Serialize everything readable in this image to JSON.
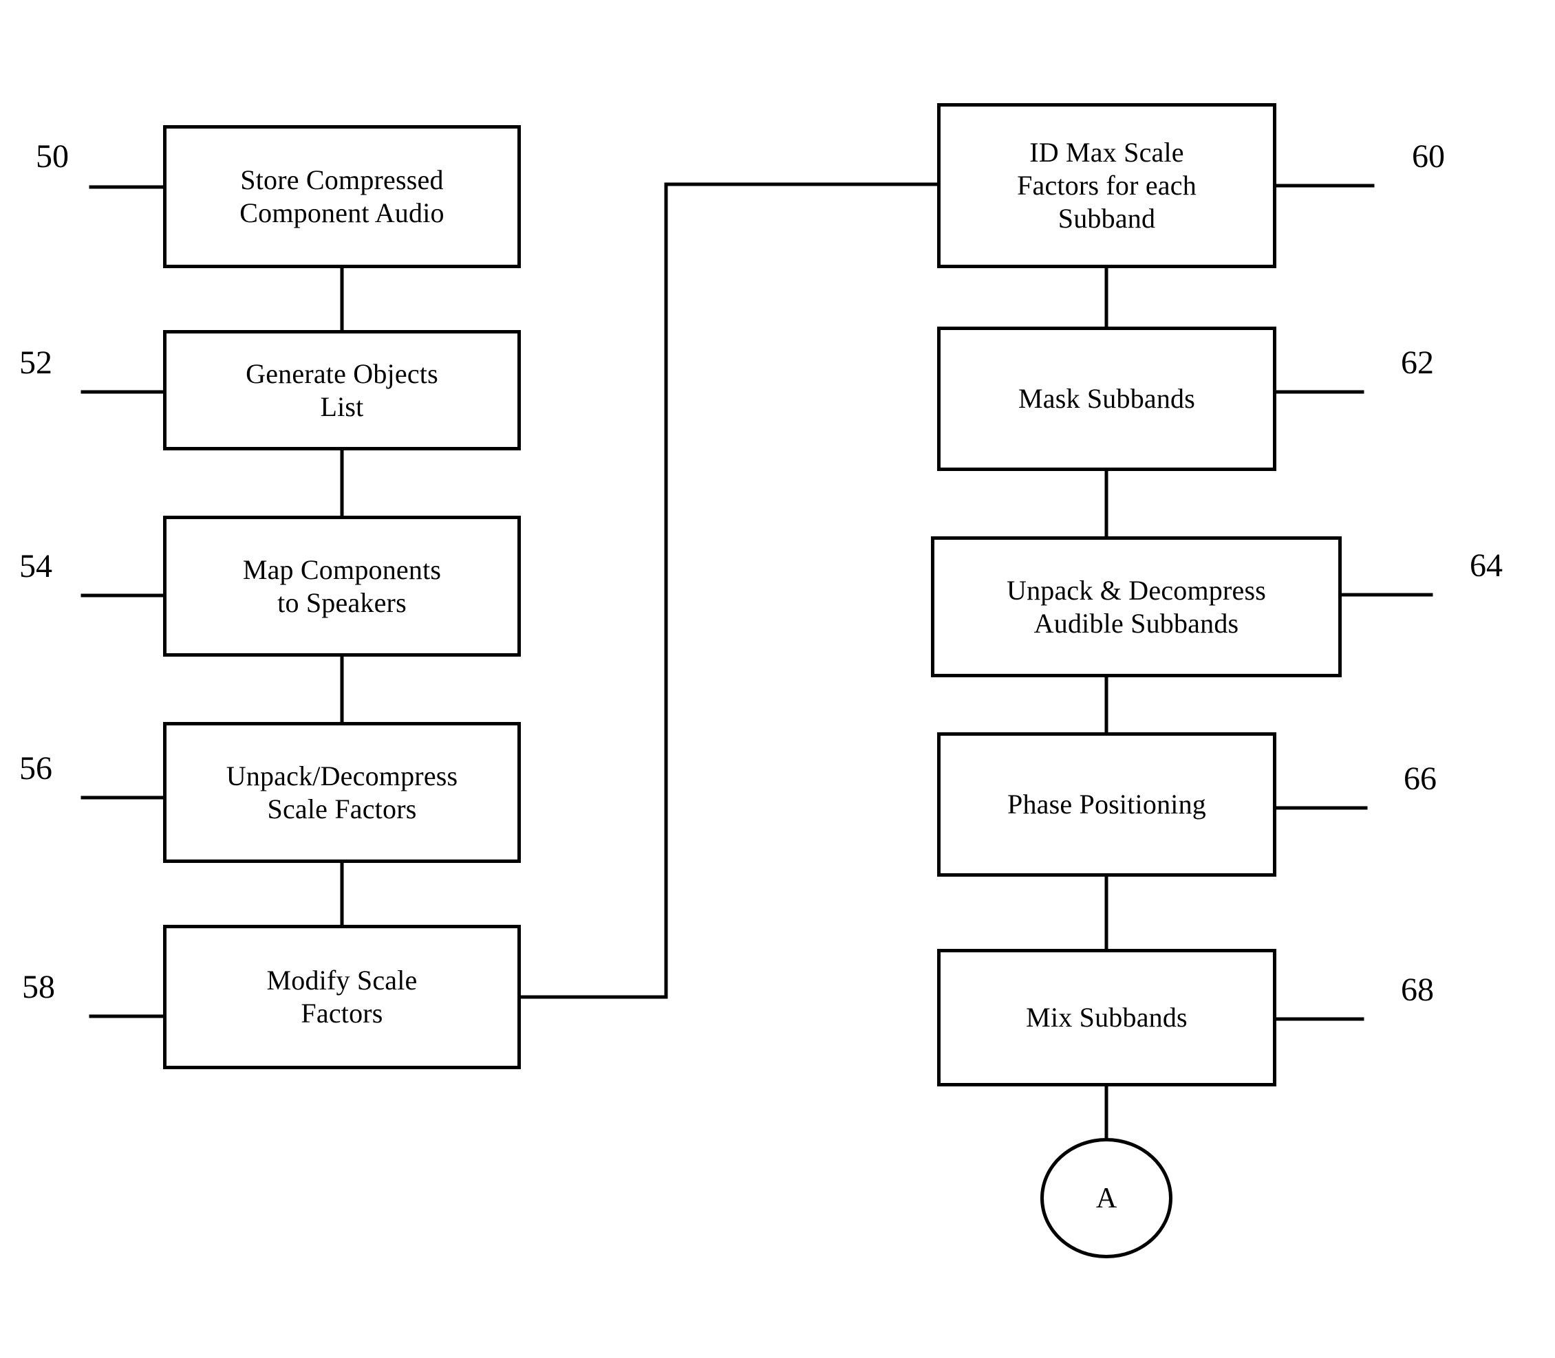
{
  "figure": {
    "type": "patent-flowchart",
    "left_column": [
      {
        "ref": "50",
        "label": "Store Compressed\nComponent Audio"
      },
      {
        "ref": "52",
        "label": "Generate Objects\nList"
      },
      {
        "ref": "54",
        "label": "Map Components\nto Speakers"
      },
      {
        "ref": "56",
        "label": "Unpack/Decompress\nScale Factors"
      },
      {
        "ref": "58",
        "label": "Modify Scale\nFactors"
      }
    ],
    "right_column": [
      {
        "ref": "60",
        "label": "ID Max Scale\nFactors for each\nSubband"
      },
      {
        "ref": "62",
        "label": "Mask Subbands"
      },
      {
        "ref": "64",
        "label": "Unpack & Decompress\nAudible Subbands"
      },
      {
        "ref": "66",
        "label": "Phase Positioning"
      },
      {
        "ref": "68",
        "label": "Mix Subbands"
      }
    ],
    "terminator": {
      "label": "A"
    },
    "colors": {
      "line": "#000000",
      "fill": "#ffffff",
      "text": "#000000"
    }
  }
}
